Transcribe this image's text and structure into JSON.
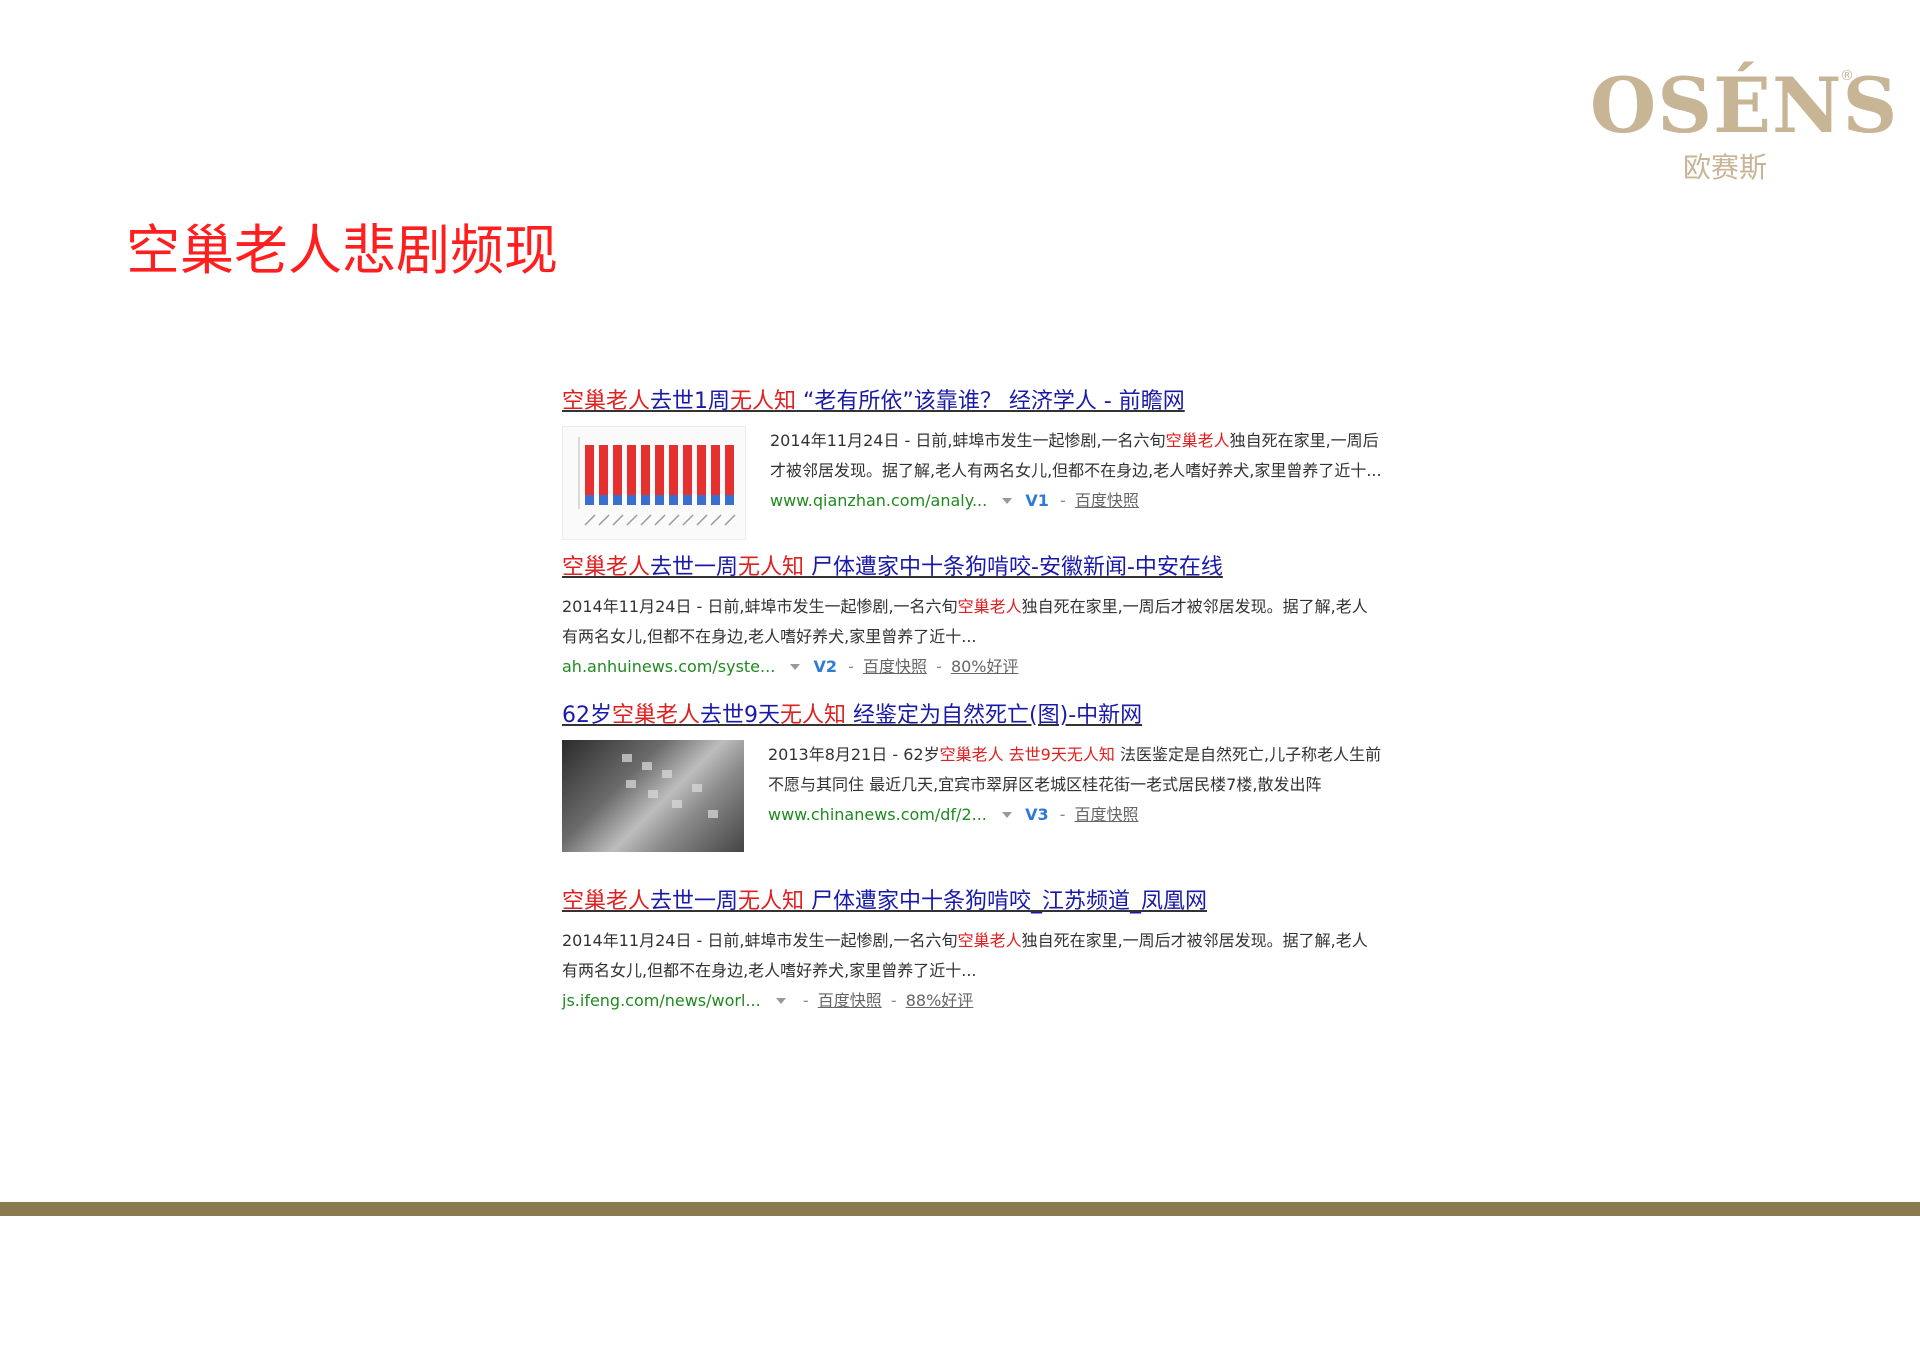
{
  "logo": {
    "en": "OSÉNS",
    "reg": "®",
    "cn": "欧赛斯"
  },
  "slide_title": "空巢老人悲剧频现",
  "results": [
    {
      "title": [
        {
          "text": "空巢老人",
          "kw": true
        },
        {
          "text": "去世1周",
          "kw": false
        },
        {
          "text": "无人知",
          "kw": true
        },
        {
          "text": " “老有所依”该靠谁？ 经济学人 - 前瞻网",
          "kw": false
        }
      ],
      "abstract": [
        {
          "text": "2014年11月24日 - 日前,蚌埠市发生一起惨剧,一名六旬",
          "hl": false
        },
        {
          "text": "空巢老人",
          "hl": true
        },
        {
          "text": "独自死在家里,一周后才被邻居发现。据了解,老人有两名女儿,但都不在身边,老人嗜好养犬,家里曾养了近十...",
          "hl": false
        }
      ],
      "url": "www.qianzhan.com/analy...",
      "v": "V1",
      "links": [
        "百度快照"
      ],
      "thumb": "chart"
    },
    {
      "title": [
        {
          "text": "空巢老人",
          "kw": true
        },
        {
          "text": "去世一周",
          "kw": false
        },
        {
          "text": "无人知",
          "kw": true
        },
        {
          "text": " 尸体遭家中十条狗啃咬-安徽新闻-中安在线",
          "kw": false
        }
      ],
      "abstract": [
        {
          "text": "2014年11月24日 - 日前,蚌埠市发生一起惨剧,一名六旬",
          "hl": false
        },
        {
          "text": "空巢老人",
          "hl": true
        },
        {
          "text": "独自死在家里,一周后才被邻居发现。据了解,老人有两名女儿,但都不在身边,老人嗜好养犬,家里曾养了近十...",
          "hl": false
        }
      ],
      "url": "ah.anhuinews.com/syste...",
      "v": "V2",
      "links": [
        "百度快照",
        "80%好评"
      ],
      "thumb": null
    },
    {
      "title": [
        {
          "text": "62岁",
          "kw": false
        },
        {
          "text": "空巢老人",
          "kw": true
        },
        {
          "text": "去世9天",
          "kw": false
        },
        {
          "text": "无人知",
          "kw": true
        },
        {
          "text": " 经鉴定为自然死亡(图)-中新网",
          "kw": false
        }
      ],
      "abstract": [
        {
          "text": "2013年8月21日 - 62岁",
          "hl": false
        },
        {
          "text": "空巢老人",
          "hl": true
        },
        {
          "text": " 去世9天",
          "hl": false
        },
        {
          "text": "无人知",
          "hl": true
        },
        {
          "text": " 法医鉴定是自然死亡,儿子称老人生前不愿与其同住 最近几天,宜宾市翠屏区老城区桂花街一老式居民楼7楼,散发出阵",
          "hl": false
        }
      ],
      "url": "www.chinanews.com/df/2...",
      "v": "V3",
      "links": [
        "百度快照"
      ],
      "thumb": "photo"
    },
    {
      "title": [
        {
          "text": "空巢老人",
          "kw": true
        },
        {
          "text": "去世一周",
          "kw": false
        },
        {
          "text": "无人知",
          "kw": true
        },
        {
          "text": " 尸体遭家中十条狗啃咬_江苏频道_凤凰网",
          "kw": false
        }
      ],
      "abstract": [
        {
          "text": "2014年11月24日 - 日前,蚌埠市发生一起惨剧,一名六旬",
          "hl": false
        },
        {
          "text": "空巢老人",
          "hl": true
        },
        {
          "text": "独自死在家里,一周后才被邻居发现。据了解,老人有两名女儿,但都不在身边,老人嗜好养犬,家里曾养了近十...",
          "hl": false
        }
      ],
      "url": "js.ifeng.com/news/worl...",
      "v": null,
      "links": [
        "百度快照",
        "88%好评"
      ],
      "thumb": null
    }
  ],
  "colors": {
    "title_red": "#ff1f1f",
    "keyword_red": "#e02020",
    "link_blue": "#1a1aa8",
    "url_green": "#1f8a1f",
    "footer_gold": "#8a7b4e",
    "logo_gold": "#c7b596"
  }
}
